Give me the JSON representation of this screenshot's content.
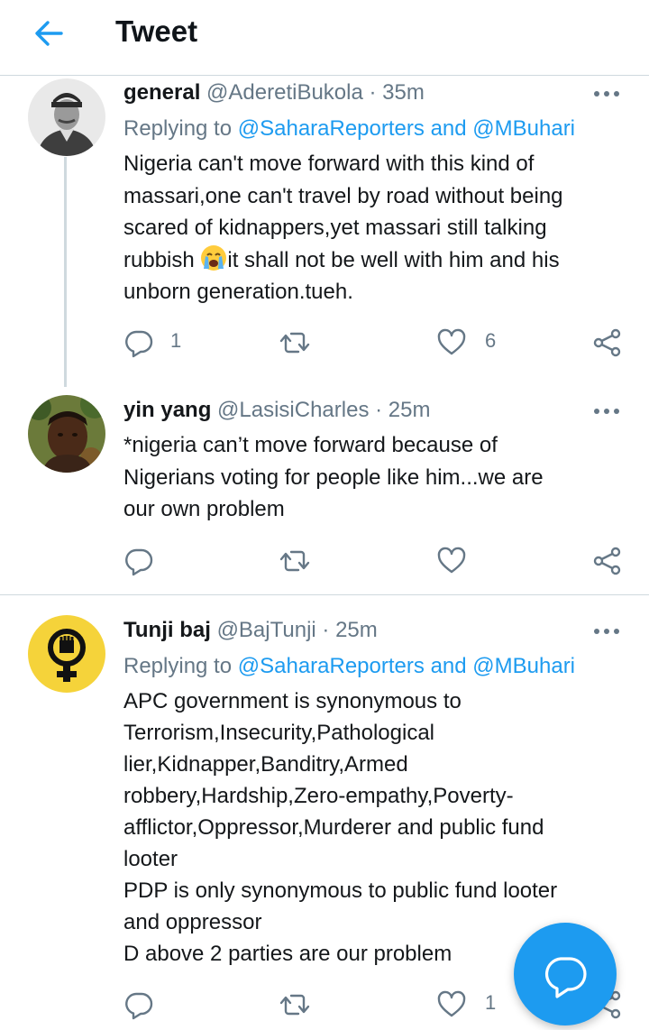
{
  "header": {
    "title": "Tweet"
  },
  "tweets": [
    {
      "name": "general",
      "handle": "@AderetiBukola",
      "time": "· 35m",
      "replying_prefix": "Replying to",
      "replying_to_1": "@SaharaReporters",
      "replying_and": "and",
      "replying_to_2": "@MBuhari",
      "lines": [
        "Nigeria can't move forward with this kind of",
        "massari,one can't travel by road without being",
        "scared of kidnappers,yet massari still talking",
        "rubbish",
        "it shall not be well with him and his",
        "unborn generation.tueh."
      ],
      "emoji": "crying-face",
      "reply_count": "1",
      "like_count": "6"
    },
    {
      "name": "yin yang",
      "handle": "@LasisiCharles",
      "time": "· 25m",
      "lines": [
        "*nigeria can’t move forward because of",
        "Nigerians voting for people like him...we are",
        "our own problem"
      ]
    },
    {
      "name": "Tunji baj",
      "handle": "@BajTunji",
      "time": "· 25m",
      "replying_prefix": "Replying to",
      "replying_to_1": "@SaharaReporters",
      "replying_and": "and",
      "replying_to_2": "@MBuhari",
      "lines": [
        "APC government is synonymous to",
        "Terrorism,Insecurity,Pathological",
        "lier,Kidnapper,Banditry,Armed",
        "robbery,Hardship,Zero-empathy,Poverty-",
        "afflictor,Oppressor,Murderer and public fund",
        "looter",
        "PDP is only synonymous to public fund looter",
        "and oppressor",
        "D above 2 parties are our problem"
      ],
      "like_count": "1"
    }
  ],
  "icons": {
    "back": "arrow-left-icon",
    "more": "more-dots-icon",
    "reply": "reply-bubble-icon",
    "retweet": "retweet-icon",
    "like": "heart-icon",
    "share": "share-icon",
    "compose": "compose-reply-icon"
  },
  "colors": {
    "accent": "#1d9bf0",
    "text": "#14171a",
    "secondary": "#657786",
    "divider": "#cfd9de"
  }
}
